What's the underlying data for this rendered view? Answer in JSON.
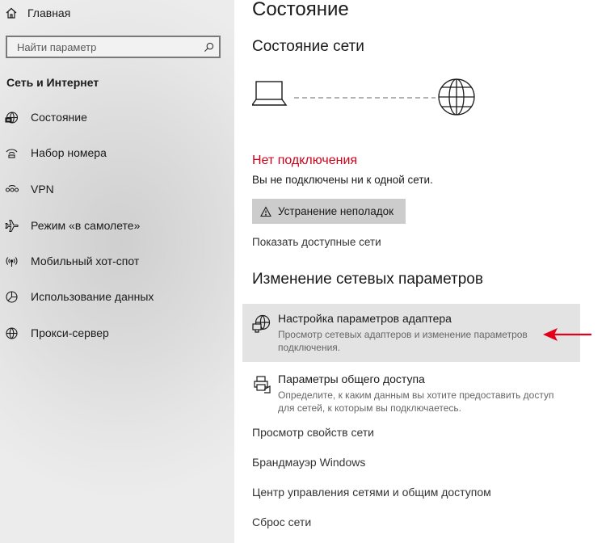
{
  "sidebar": {
    "home_label": "Главная",
    "search_placeholder": "Найти параметр",
    "section_title": "Сеть и Интернет",
    "items": [
      {
        "label": "Состояние",
        "icon": "network-status-icon"
      },
      {
        "label": "Набор номера",
        "icon": "dial-up-icon"
      },
      {
        "label": "VPN",
        "icon": "vpn-icon"
      },
      {
        "label": "Режим «в самолете»",
        "icon": "airplane-icon"
      },
      {
        "label": "Мобильный хот-спот",
        "icon": "hotspot-icon"
      },
      {
        "label": "Использование данных",
        "icon": "data-usage-icon"
      },
      {
        "label": "Прокси-сервер",
        "icon": "globe-icon"
      }
    ]
  },
  "main": {
    "page_title": "Состояние",
    "network_status_heading": "Состояние сети",
    "connection_status": "Нет подключения",
    "connection_desc": "Вы не подключены ни к одной сети.",
    "troubleshoot_label": "Устранение неполадок",
    "show_networks_link": "Показать доступные сети",
    "change_heading": "Изменение сетевых параметров",
    "options": [
      {
        "title": "Настройка параметров адаптера",
        "desc": "Просмотр сетевых адаптеров и изменение параметров подключения."
      },
      {
        "title": "Параметры общего доступа",
        "desc": "Определите, к каким данным вы хотите предоставить доступ для сетей, к которым вы подключаетесь."
      }
    ],
    "links": [
      "Просмотр свойств сети",
      "Брандмауэр Windows",
      "Центр управления сетями и общим доступом",
      "Сброс сети"
    ]
  },
  "colors": {
    "error": "#d0021b",
    "annotation_arrow": "#e3001b",
    "highlight_bg": "#e3e3e3",
    "button_bg": "#cccccc"
  }
}
